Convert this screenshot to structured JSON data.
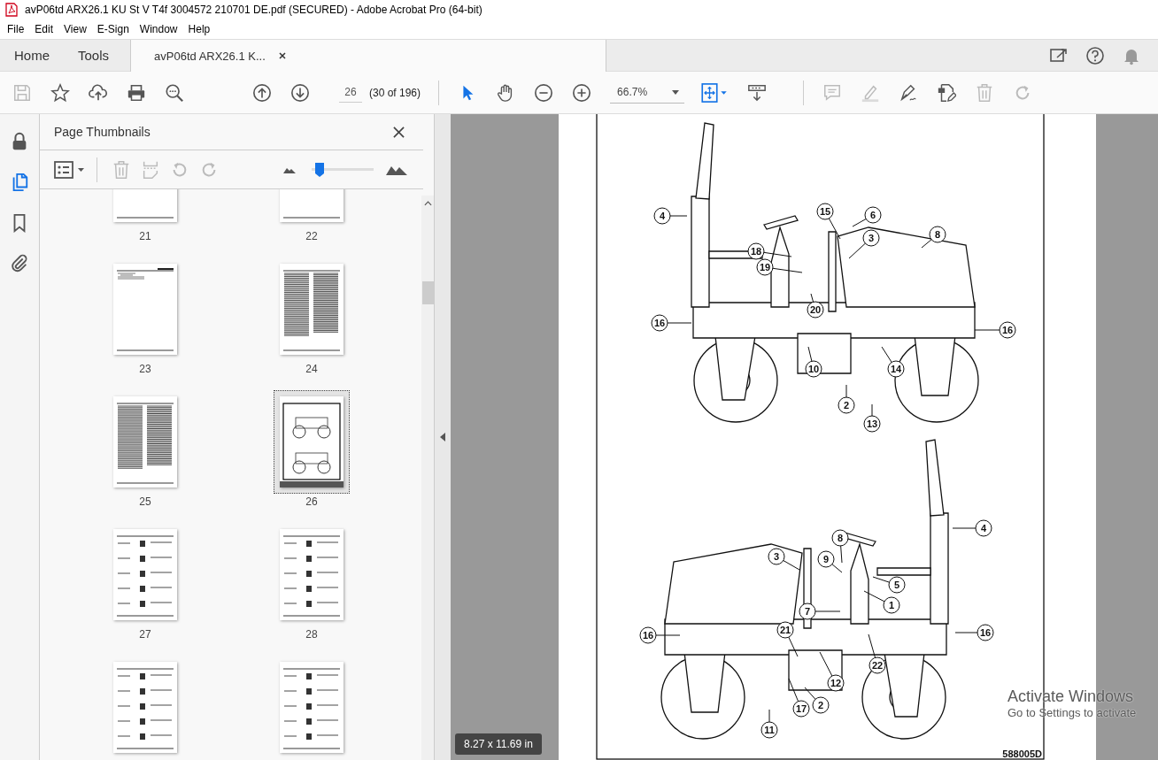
{
  "window": {
    "title": "avP06td ARX26.1 KU St V T4f 3004572 210701 DE.pdf (SECURED) - Adobe Acrobat Pro (64-bit)"
  },
  "menu": [
    "File",
    "Edit",
    "View",
    "E-Sign",
    "Window",
    "Help"
  ],
  "tabs": [
    {
      "label": "Home",
      "kind": "nav",
      "selected": false
    },
    {
      "label": "Tools",
      "kind": "nav",
      "selected": false
    },
    {
      "label": "avP06td ARX26.1 K...",
      "kind": "document",
      "selected": true
    }
  ],
  "header_tools": [
    {
      "kind": "share",
      "disabled": false
    },
    {
      "kind": "help",
      "disabled": false
    },
    {
      "kind": "bell",
      "disabled": true
    }
  ],
  "toolbar": {
    "file_tools": [
      {
        "kind": "save",
        "disabled": true
      },
      {
        "kind": "star",
        "disabled": false
      },
      {
        "kind": "upload",
        "disabled": false
      },
      {
        "kind": "print",
        "disabled": false
      },
      {
        "kind": "find",
        "disabled": false
      }
    ],
    "page_number": "26",
    "page_count": "(30 of 196)",
    "mode_tools": [
      {
        "kind": "select",
        "selected": true
      },
      {
        "kind": "hand",
        "selected": false
      }
    ],
    "zoom": "66.7%",
    "edit_tools": [
      {
        "kind": "comment",
        "disabled": true
      },
      {
        "kind": "highlight",
        "disabled": true
      },
      {
        "kind": "sign",
        "disabled": false
      },
      {
        "kind": "edit",
        "disabled": false
      },
      {
        "kind": "delete",
        "disabled": true
      },
      {
        "kind": "redo",
        "disabled": true
      }
    ]
  },
  "sidebar": {
    "rail": [
      {
        "kind": "lock",
        "selected": false
      },
      {
        "kind": "pages",
        "selected": true
      },
      {
        "kind": "bookmarks",
        "selected": false
      },
      {
        "kind": "attachments",
        "selected": false
      }
    ],
    "panel": {
      "title": "Page Thumbnails",
      "tools": [
        {
          "kind": "delete",
          "disabled": true
        },
        {
          "kind": "extract",
          "disabled": true
        },
        {
          "kind": "rotate_left",
          "disabled": true
        },
        {
          "kind": "rotate_right",
          "disabled": true
        }
      ],
      "size_slider": {
        "level": 0.06
      },
      "thumbnails": [
        {
          "label": "21",
          "kind": "blank",
          "selected": false
        },
        {
          "label": "22",
          "kind": "blank",
          "selected": false
        },
        {
          "label": "23",
          "kind": "sparse",
          "selected": false
        },
        {
          "label": "24",
          "kind": "text",
          "selected": false
        },
        {
          "label": "25",
          "kind": "text",
          "selected": false
        },
        {
          "label": "26",
          "kind": "drawing",
          "selected": true
        },
        {
          "label": "27",
          "kind": "list",
          "selected": false
        },
        {
          "label": "28",
          "kind": "list",
          "selected": false
        },
        {
          "kind": "list",
          "selected": false
        },
        {
          "kind": "list",
          "selected": false
        }
      ]
    }
  },
  "document": {
    "figure_id": "588005D",
    "diagrams": [
      {
        "callouts": [
          "4",
          "15",
          "6",
          "3",
          "8",
          "18",
          "19",
          "20",
          "16",
          "16",
          "14",
          "10",
          "2",
          "13"
        ]
      },
      {
        "callouts": [
          "4",
          "8",
          "3",
          "9",
          "5",
          "1",
          "7",
          "21",
          "16",
          "16",
          "22",
          "12",
          "17",
          "2",
          "11"
        ]
      }
    ]
  },
  "status": {
    "page_size": "8.27 x 11.69 in"
  },
  "os_notice": {
    "title": "Activate Windows",
    "subtitle": "Go to Settings to activate"
  }
}
